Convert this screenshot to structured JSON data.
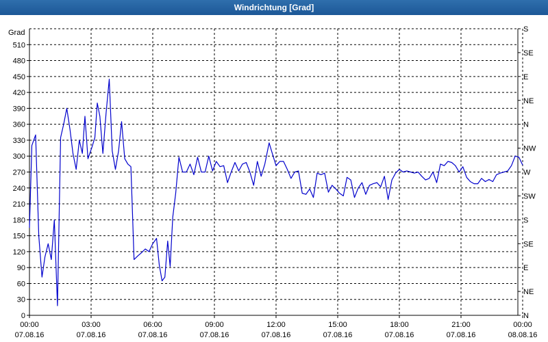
{
  "window": {
    "title": "Windrichtung [Grad]"
  },
  "chart_data": {
    "type": "line",
    "title": "Windrichtung [Grad]",
    "ylabel": "Grad",
    "ylim": [
      0,
      540
    ],
    "yticks": [
      0,
      30,
      60,
      90,
      120,
      150,
      180,
      210,
      240,
      270,
      300,
      330,
      360,
      390,
      420,
      450,
      480,
      510
    ],
    "y2ticks": [
      {
        "value": 0,
        "label": "N"
      },
      {
        "value": 45,
        "label": "NE"
      },
      {
        "value": 90,
        "label": "E"
      },
      {
        "value": 135,
        "label": "SE"
      },
      {
        "value": 180,
        "label": "S"
      },
      {
        "value": 225,
        "label": "SW"
      },
      {
        "value": 270,
        "label": "W"
      },
      {
        "value": 315,
        "label": "NW"
      },
      {
        "value": 360,
        "label": "N"
      },
      {
        "value": 405,
        "label": "NE"
      },
      {
        "value": 450,
        "label": "E"
      },
      {
        "value": 495,
        "label": "SE"
      },
      {
        "value": 540,
        "label": "S"
      }
    ],
    "xlim": [
      0,
      24
    ],
    "xticks": [
      {
        "hour": 0,
        "time": "00:00",
        "date": "07.08.16"
      },
      {
        "hour": 3,
        "time": "03:00",
        "date": "07.08.16"
      },
      {
        "hour": 6,
        "time": "06:00",
        "date": "07.08.16"
      },
      {
        "hour": 9,
        "time": "09:00",
        "date": "07.08.16"
      },
      {
        "hour": 12,
        "time": "12:00",
        "date": "07.08.16"
      },
      {
        "hour": 15,
        "time": "15:00",
        "date": "07.08.16"
      },
      {
        "hour": 18,
        "time": "18:00",
        "date": "07.08.16"
      },
      {
        "hour": 21,
        "time": "21:00",
        "date": "07.08.16"
      },
      {
        "hour": 24,
        "time": "00:00",
        "date": "08.08.16"
      }
    ],
    "grid": true,
    "series": [
      {
        "color": "#0000cc",
        "points": [
          [
            0.0,
            165
          ],
          [
            0.13,
            320
          ],
          [
            0.33,
            340
          ],
          [
            0.5,
            150
          ],
          [
            0.67,
            72
          ],
          [
            0.83,
            110
          ],
          [
            1.0,
            135
          ],
          [
            1.17,
            105
          ],
          [
            1.33,
            180
          ],
          [
            1.5,
            18
          ],
          [
            1.67,
            335
          ],
          [
            1.83,
            360
          ],
          [
            2.0,
            390
          ],
          [
            2.17,
            350
          ],
          [
            2.33,
            305
          ],
          [
            2.5,
            275
          ],
          [
            2.67,
            330
          ],
          [
            2.83,
            305
          ],
          [
            2.97,
            375
          ],
          [
            3.13,
            295
          ],
          [
            3.33,
            315
          ],
          [
            3.5,
            335
          ],
          [
            3.63,
            400
          ],
          [
            3.77,
            375
          ],
          [
            3.93,
            305
          ],
          [
            4.1,
            380
          ],
          [
            4.27,
            445
          ],
          [
            4.43,
            310
          ],
          [
            4.6,
            275
          ],
          [
            4.77,
            310
          ],
          [
            4.93,
            365
          ],
          [
            5.1,
            295
          ],
          [
            5.27,
            285
          ],
          [
            5.43,
            280
          ],
          [
            5.6,
            105
          ],
          [
            5.8,
            112
          ],
          [
            6.0,
            118
          ],
          [
            6.2,
            125
          ],
          [
            6.4,
            120
          ],
          [
            6.6,
            135
          ],
          [
            6.8,
            145
          ],
          [
            6.95,
            95
          ],
          [
            7.1,
            65
          ],
          [
            7.25,
            72
          ],
          [
            7.4,
            140
          ],
          [
            7.53,
            92
          ],
          [
            7.67,
            185
          ],
          [
            7.83,
            230
          ],
          [
            8.0,
            298
          ],
          [
            8.2,
            270
          ],
          [
            8.4,
            270
          ],
          [
            8.6,
            285
          ],
          [
            8.8,
            265
          ],
          [
            9.0,
            298
          ],
          [
            9.2,
            270
          ],
          [
            9.4,
            270
          ],
          [
            9.6,
            300
          ],
          [
            9.8,
            272
          ],
          [
            10.0,
            290
          ],
          [
            10.2,
            280
          ],
          [
            10.4,
            282
          ],
          [
            10.6,
            250
          ],
          [
            10.8,
            270
          ],
          [
            11.0,
            288
          ],
          [
            11.2,
            272
          ],
          [
            11.4,
            285
          ],
          [
            11.6,
            288
          ],
          [
            11.8,
            270
          ],
          [
            12.0,
            245
          ],
          [
            12.2,
            290
          ],
          [
            12.4,
            262
          ],
          [
            12.6,
            285
          ],
          [
            12.83,
            325
          ],
          [
            13.0,
            305
          ],
          [
            13.2,
            282
          ],
          [
            13.4,
            290
          ],
          [
            13.6,
            290
          ],
          [
            13.8,
            275
          ],
          [
            14.0,
            258
          ],
          [
            14.2,
            270
          ],
          [
            14.4,
            272
          ],
          [
            14.6,
            230
          ],
          [
            14.8,
            228
          ],
          [
            15.0,
            238
          ],
          [
            15.2,
            222
          ],
          [
            15.4,
            268
          ],
          [
            15.6,
            265
          ],
          [
            15.8,
            268
          ],
          [
            16.0,
            232
          ],
          [
            16.2,
            245
          ],
          [
            16.4,
            238
          ],
          [
            16.6,
            230
          ],
          [
            16.8,
            225
          ],
          [
            17.0,
            260
          ],
          [
            17.2,
            255
          ],
          [
            17.4,
            222
          ],
          [
            17.6,
            240
          ],
          [
            17.8,
            250
          ],
          [
            18.0,
            228
          ],
          [
            18.2,
            245
          ],
          [
            18.4,
            248
          ],
          [
            18.6,
            250
          ],
          [
            18.8,
            242
          ],
          [
            19.0,
            262
          ],
          [
            19.2,
            218
          ],
          [
            19.4,
            255
          ],
          [
            19.6,
            268
          ],
          [
            19.8,
            275
          ],
          [
            20.0,
            270
          ],
          [
            20.2,
            272
          ],
          [
            20.4,
            270
          ],
          [
            20.6,
            268
          ],
          [
            20.8,
            270
          ],
          [
            21.0,
            262
          ],
          [
            21.2,
            255
          ],
          [
            21.4,
            258
          ],
          [
            21.6,
            270
          ],
          [
            21.8,
            250
          ],
          [
            22.0,
            285
          ],
          [
            22.2,
            282
          ],
          [
            22.4,
            290
          ],
          [
            22.6,
            288
          ],
          [
            22.8,
            282
          ],
          [
            23.0,
            270
          ],
          [
            23.2,
            280
          ],
          [
            23.4,
            260
          ],
          [
            23.6,
            252
          ],
          [
            23.8,
            248
          ],
          [
            24.0,
            248
          ],
          [
            24.2,
            258
          ],
          [
            24.4,
            252
          ],
          [
            24.6,
            256
          ],
          [
            24.8,
            252
          ],
          [
            25.0,
            265
          ],
          [
            25.2,
            268
          ],
          [
            25.4,
            270
          ],
          [
            25.6,
            272
          ],
          [
            25.8,
            282
          ],
          [
            26.0,
            300
          ],
          [
            26.2,
            298
          ],
          [
            26.4,
            283
          ]
        ]
      }
    ]
  }
}
